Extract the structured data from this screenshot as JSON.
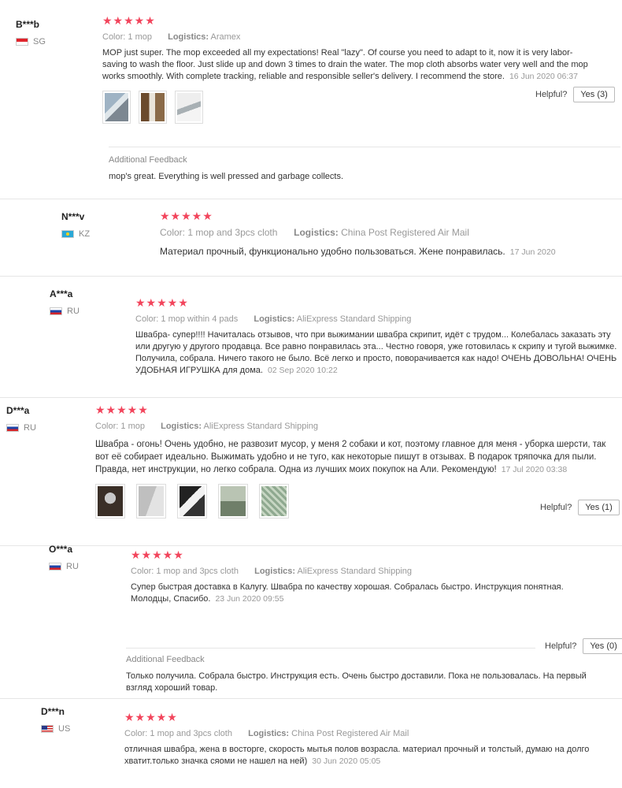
{
  "labels": {
    "color": "Color:",
    "logistics": "Logistics:",
    "helpful": "Helpful?",
    "additional_feedback": "Additional Feedback",
    "stars": "★★★★★"
  },
  "colors": {
    "star": "#f2455c",
    "meta": "#999999",
    "text": "#333333"
  },
  "reviews": [
    {
      "user": "B***b",
      "country": "SG",
      "flag_icon": "singapore-flag-icon",
      "rating": 5,
      "color": "1 mop",
      "logistics": "Aramex",
      "text": "MOP just super. The mop exceeded all my expectations! Real \"lazy\". Of course you need to adapt to it, now it is very labor-saving to wash the floor. Just slide up and down 3 times to drain the water. The mop cloth absorbs water very well and the mop works smoothly. With complete tracking, reliable and responsible seller's delivery. I recommend the store.",
      "date": "16 Jun 2020 06:37",
      "helpful_count": "Yes (3)",
      "photos": [
        "mop-photo-1",
        "mop-photo-2",
        "mop-photo-3"
      ],
      "additional_feedback": "mop's great. Everything is well pressed and garbage collects."
    },
    {
      "user": "N***v",
      "country": "KZ",
      "flag_icon": "kazakhstan-flag-icon",
      "rating": 5,
      "color": "1 mop and 3pcs cloth",
      "logistics": "China Post Registered Air Mail",
      "text": "Материал прочный, функционально удобно пользоваться. Жене понравилась.",
      "date": "17 Jun 2020"
    },
    {
      "user": "A***a",
      "country": "RU",
      "flag_icon": "russia-flag-icon",
      "rating": 5,
      "color": "1 mop within 4 pads",
      "logistics": "AliExpress Standard Shipping",
      "text": "Швабра- супер!!!! Начиталась отзывов, что при выжимании швабра скрипит, идёт с трудом... Колебалась заказать эту или другую у другого продавца. Все равно понравилась эта... Честно говоря, уже готовилась к скрипу и тугой выжимке. Получила, собрала. Ничего такого не было. Всё легко и просто, поворачивается как надо! ОЧЕНЬ ДОВОЛЬНА! ОЧЕНЬ УДОБНАЯ ИГРУШКА для дома.",
      "date": "02 Sep 2020 10:22"
    },
    {
      "user": "D***a",
      "country": "RU",
      "flag_icon": "russia-flag-icon",
      "rating": 5,
      "color": "1 mop",
      "logistics": "AliExpress Standard Shipping",
      "text": "Швабра - огонь! Очень удобно, не развозит мусор, у меня 2 собаки и кот, поэтому главное для меня - уборка шерсти, так вот её собирает идеально. Выжимать удобно и не туго, как некоторые пишут в отзывах. В подарок тряпочка для пыли. Правда, нет инструкции, но легко собрала. Одна из лучших моих покупок на Али. Рекомендую!",
      "date": "17 Jul 2020 03:38",
      "helpful_count": "Yes (1)",
      "photos": [
        "mop-photo-4",
        "mop-photo-5",
        "mop-photo-6",
        "mop-photo-7",
        "mop-photo-8"
      ]
    },
    {
      "user": "O***a",
      "country": "RU",
      "flag_icon": "russia-flag-icon",
      "rating": 5,
      "color": "1 mop and 3pcs cloth",
      "logistics": "AliExpress Standard Shipping",
      "text": "Супер быстрая доставка в Калугу. Швабра по качеству хорошая. Собралась быстро. Инструкция понятная. Молодцы, Спасибо.",
      "date": "23 Jun 2020 09:55",
      "helpful_count": "Yes (0)",
      "additional_feedback": "Только получила. Собрала быстро. Инструкция есть. Очень быстро доставили. Пока не пользовалась. На первый взгляд хороший товар."
    },
    {
      "user": "D***n",
      "country": "US",
      "flag_icon": "usa-flag-icon",
      "rating": 5,
      "color": "1 mop and 3pcs cloth",
      "logistics": "China Post Registered Air Mail",
      "text": "отличная швабра, жена в восторге, скорость мытья полов возрасла. материал прочный и толстый, думаю на долго хватит.только значка сяоми не нашел на ней)",
      "date": "30 Jun 2020 05:05"
    }
  ]
}
